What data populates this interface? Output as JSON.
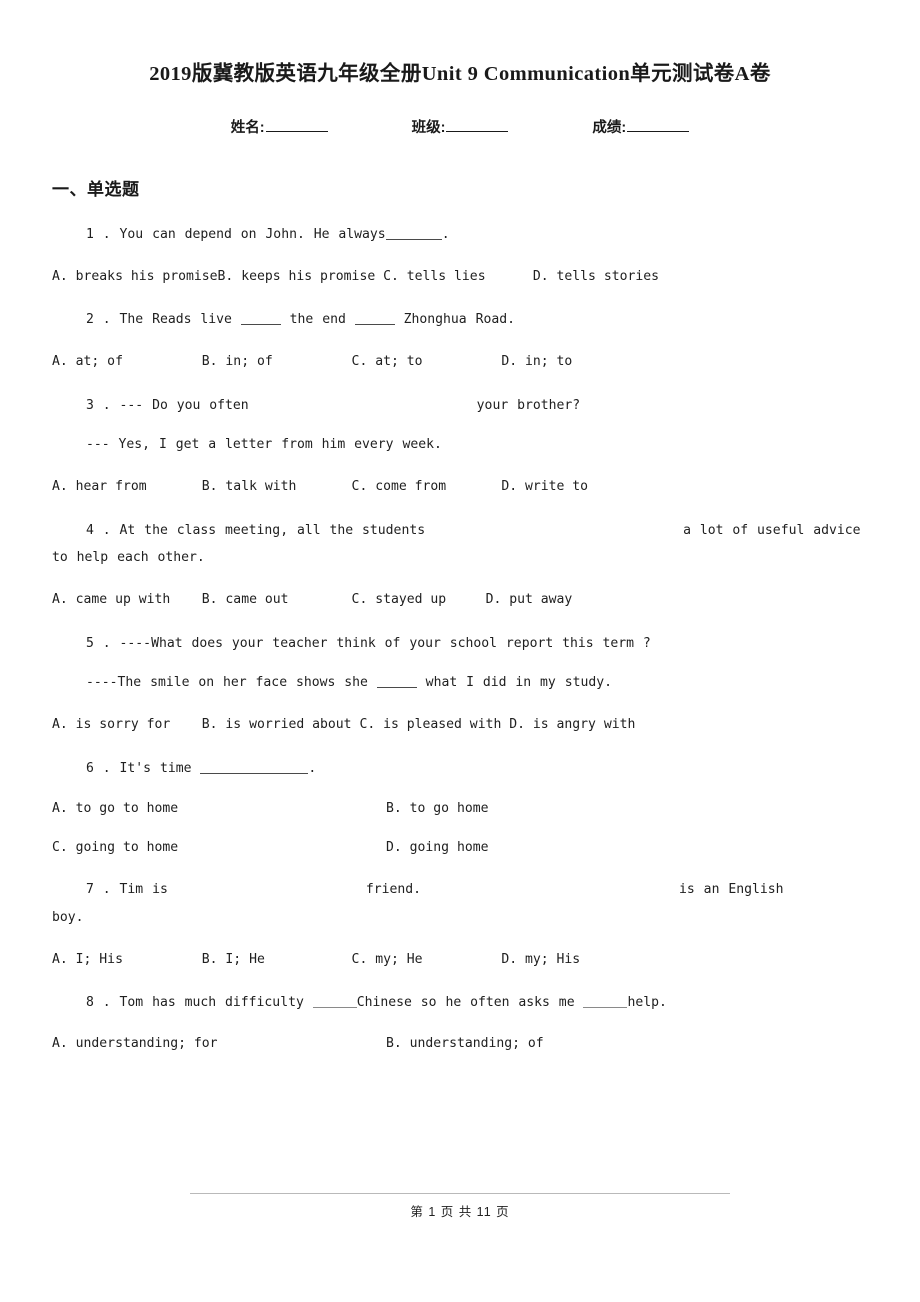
{
  "document": {
    "title": "2019版冀教版英语九年级全册Unit 9 Communication单元测试卷A卷",
    "identity": {
      "name_label": "姓名:",
      "class_label": "班级:",
      "score_label": "成绩:"
    },
    "sections": [
      {
        "heading": "一、单选题"
      }
    ],
    "questions": [
      {
        "number": "1",
        "stem_prefix": "1 . You can depend on John. He always",
        "stem_suffix": ".",
        "options_line": "A. breaks his promiseB. keeps his promise C. tells lies      D. tells stories"
      },
      {
        "number": "2",
        "stem_a": "2 . The Reads live ",
        "stem_b": " the end ",
        "stem_c": " Zhonghua Road.",
        "options_line": "A. at; of          B. in; of          C. at; to          D. in; to"
      },
      {
        "number": "3",
        "stem_a": "3 . --- Do you often",
        "stem_b": "your brother?",
        "sub_line": "--- Yes, I get a letter from him every week.",
        "options_line": "A. hear from       B. talk with       C. come from       D. write to"
      },
      {
        "number": "4",
        "stem_a": "4 . At the class meeting, all the students",
        "stem_b": "a lot of useful advice",
        "stem_cont": "to help each other.",
        "options_line": "A. came up with    B. came out        C. stayed up     D. put away"
      },
      {
        "number": "5",
        "stem_a": "5 . ----What does your teacher think of your school report this term ?",
        "sub_a": "----The smile on her face shows she ",
        "sub_b": " what I did in my study.",
        "options_line": "A. is sorry for    B. is worried about C. is pleased with D. is angry with"
      },
      {
        "number": "6",
        "stem_prefix": "6 . It's time ",
        "stem_suffix": ".",
        "options_grid": [
          [
            "A. to go to home",
            "B. to go home"
          ],
          [
            "C. going to home",
            "D. going home"
          ]
        ]
      },
      {
        "number": "7",
        "stem_a": "7 . Tim is",
        "stem_b": "friend.",
        "stem_c": "is an English",
        "stem_cont": "boy.",
        "options_line": "A. I; His          B. I; He           C. my; He          D. my; His"
      },
      {
        "number": "8",
        "stem_a": "8 . Tom has much difficulty ",
        "stem_b": "Chinese so he often asks me ",
        "stem_c": "help.",
        "options_grid": [
          [
            "A. understanding; for",
            "B. understanding; of"
          ]
        ]
      }
    ],
    "footer": {
      "page_text": "第 1 页 共 11 页",
      "current_page": "1",
      "total_pages": "11"
    }
  }
}
